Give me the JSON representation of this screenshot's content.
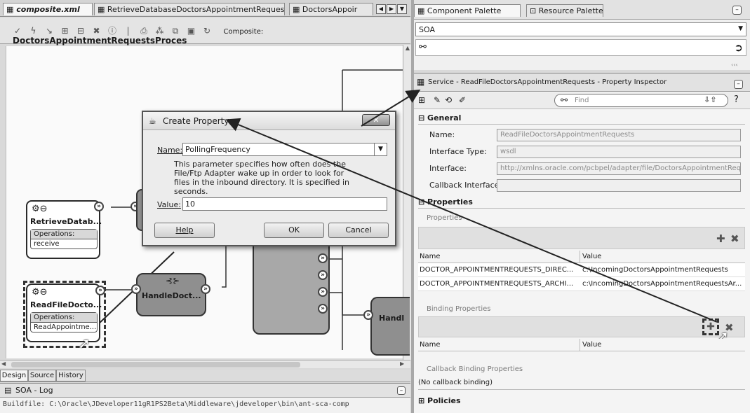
{
  "editor": {
    "tabs": [
      {
        "label": "composite.xml"
      },
      {
        "label": "RetrieveDatabaseDoctorsAppointmentRequests_db.jca"
      },
      {
        "label": "DoctorsAppoir"
      }
    ],
    "composite_label": "Composite:",
    "composite_name": "DoctorsAppointmentRequestsProces",
    "bottom_tabs": [
      "Design",
      "Source",
      "History"
    ]
  },
  "components": {
    "retrieve": {
      "title": "RetrieveDatab...",
      "ops_header": "Operations:",
      "op": "receive"
    },
    "readfile": {
      "title": "ReadFileDocto...",
      "ops_header": "Operations:",
      "op": "ReadAppointme..."
    },
    "handle": {
      "title": "HandleDoct..."
    },
    "handl_right": {
      "title": "Handl"
    }
  },
  "log": {
    "title": "SOA - Log",
    "line": "Buildfile: C:\\Oracle\\JDeveloper11gR1PS2Beta\\Middleware\\jdeveloper\\bin\\ant-sca-comp"
  },
  "dialog": {
    "title": "Create Property",
    "name_label": "Name:",
    "name_value": "PollingFrequency",
    "description": "This parameter specifies how often does the File/Ftp Adapter wake up in order to look for files in the inbound directory. It is specified in seconds.",
    "value_label": "Value:",
    "value_value": "10",
    "help": "Help",
    "ok": "OK",
    "cancel": "Cancel"
  },
  "palette": {
    "tabs": [
      "Component Palette",
      "Resource Palette"
    ],
    "selected": "SOA"
  },
  "inspector": {
    "title": "Service - ReadFileDoctorsAppointmentRequests - Property Inspector",
    "find_placeholder": "Find",
    "general": "General",
    "fields": [
      {
        "label": "Name:",
        "value": "ReadFileDoctorsAppointmentRequests"
      },
      {
        "label": "Interface Type:",
        "value": "wsdl"
      },
      {
        "label": "Interface:",
        "value": "http://xmlns.oracle.com/pcbpel/adapter/file/DoctorsAppointmentReque"
      },
      {
        "label": "Callback Interface:",
        "value": ""
      }
    ],
    "properties_section": "Properties",
    "properties_sub": "Properties",
    "col_name": "Name",
    "col_value": "Value",
    "rows": [
      {
        "name": "DOCTOR_APPOINTMENTREQUESTS_DIREC...",
        "value": "c:\\IncomingDoctorsAppointmentRequests"
      },
      {
        "name": "DOCTOR_APPOINTMENTREQUESTS_ARCHI...",
        "value": "c:\\IncomingDoctorsAppointmentRequestsAr..."
      }
    ],
    "binding_sub": "Binding Properties",
    "callback_sub": "Callback Binding Properties",
    "no_callback": "(No callback binding)",
    "policies": "Policies"
  }
}
